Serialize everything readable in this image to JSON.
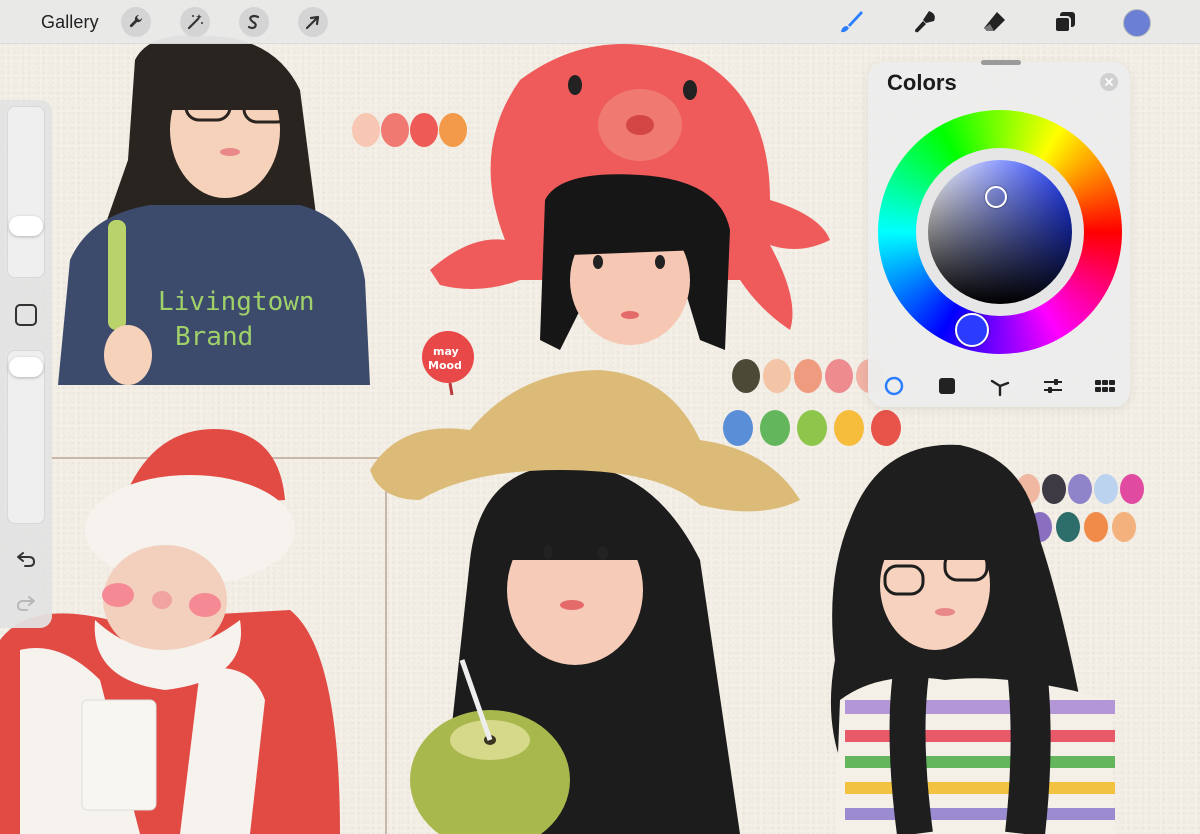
{
  "toolbar": {
    "gallery_label": "Gallery",
    "left_tools": [
      {
        "name": "actions",
        "icon": "wrench-icon"
      },
      {
        "name": "adjustments",
        "icon": "magic-wand-icon"
      },
      {
        "name": "selection",
        "icon": "selection-s-icon"
      },
      {
        "name": "transform",
        "icon": "arrow-cursor-icon"
      }
    ],
    "right_tools": [
      {
        "name": "brush",
        "icon": "brush-icon",
        "active": true
      },
      {
        "name": "smudge",
        "icon": "smudge-icon"
      },
      {
        "name": "eraser",
        "icon": "eraser-icon"
      },
      {
        "name": "layers",
        "icon": "layers-icon"
      }
    ],
    "current_color": "#6b80d4",
    "accent_color": "#2b7fff"
  },
  "sidebar": {
    "brush_size_level": 0.28,
    "opacity_level": 0.96,
    "undo_icon": "undo-icon",
    "redo_icon": "redo-icon"
  },
  "colors_panel": {
    "title": "Colors",
    "active_mode": "disc",
    "modes": [
      {
        "name": "disc",
        "icon": "disc-mode-icon"
      },
      {
        "name": "classic",
        "icon": "square-mode-icon"
      },
      {
        "name": "harmony",
        "icon": "harmony-mode-icon"
      },
      {
        "name": "value",
        "icon": "sliders-mode-icon"
      },
      {
        "name": "palettes",
        "icon": "grid-mode-icon"
      }
    ],
    "selected_color": "#6b80d4"
  },
  "artwork": {
    "shirt_text_line1": "Livingtown",
    "shirt_text_line2": "Brand",
    "badge_text_line1": "may",
    "badge_text_line2": "Mood",
    "swatches_top": [
      "#f8c7b3",
      "#f07a72",
      "#ee5a55",
      "#f39a4a"
    ],
    "swatches_middle_row1": [
      "#4b4a36",
      "#f4c4a6",
      "#ef9b7f",
      "#ed8b8e",
      "#f0b3a6"
    ],
    "swatches_middle_row2": [
      "#5a8fd8",
      "#63b65b",
      "#8ec64c",
      "#f6bd3d",
      "#e8534a"
    ],
    "swatches_right_row1": [
      "#f0b8a0",
      "#3e3a44",
      "#8f84c9",
      "#bcd3f0",
      "#e04aa0"
    ],
    "swatches_right_row2": [
      "#8a6fc0",
      "#2e6e6a",
      "#f08b4a",
      "#f3b17d"
    ]
  }
}
